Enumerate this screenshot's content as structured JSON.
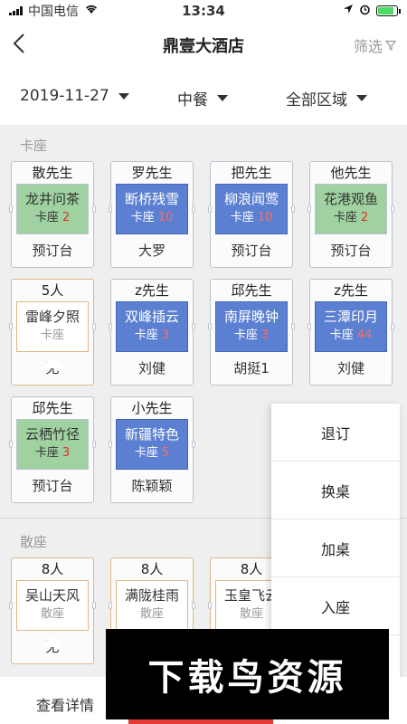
{
  "status": {
    "carrier": "中国电信",
    "time": "13:34"
  },
  "nav": {
    "title": "鼎壹大酒店",
    "filter_label": "筛选"
  },
  "filters": {
    "date": "2019-11-27",
    "meal": "中餐",
    "area": "全部区域"
  },
  "sections": {
    "booth": "卡座",
    "hall": "散座"
  },
  "booths": [
    {
      "top": "散先生",
      "name": "龙井问茶",
      "type": "卡座",
      "count": "2",
      "bottom": "预订台",
      "style": "green"
    },
    {
      "top": "罗先生",
      "name": "断桥残雪",
      "type": "卡座",
      "count": "10",
      "bottom": "大罗",
      "style": "blue"
    },
    {
      "top": "把先生",
      "name": "柳浪闻莺",
      "type": "卡座",
      "count": "10",
      "bottom": "预订台",
      "style": "blue"
    },
    {
      "top": "他先生",
      "name": "花港观鱼",
      "type": "卡座",
      "count": "2",
      "bottom": "预订台",
      "style": "green"
    },
    {
      "top": "5人",
      "name": "雷峰夕照",
      "type": "卡座",
      "count": "",
      "bottom": "无",
      "style": "orange"
    },
    {
      "top": "z先生",
      "name": "双峰插云",
      "type": "卡座",
      "count": "3",
      "bottom": "刘健",
      "style": "blue"
    },
    {
      "top": "邱先生",
      "name": "南屏晚钟",
      "type": "卡座",
      "count": "3",
      "bottom": "胡挺1",
      "style": "blue"
    },
    {
      "top": "z先生",
      "name": "三潭印月",
      "type": "卡座",
      "count": "44",
      "bottom": "刘健",
      "style": "blue"
    },
    {
      "top": "邱先生",
      "name": "云栖竹径",
      "type": "卡座",
      "count": "3",
      "bottom": "预订台",
      "style": "green"
    },
    {
      "top": "小先生",
      "name": "新疆特色",
      "type": "卡座",
      "count": "5",
      "bottom": "陈颖颖",
      "style": "blue"
    }
  ],
  "halls": [
    {
      "top": "8人",
      "name": "吴山天风",
      "type": "散座",
      "count": "",
      "bottom": "无",
      "style": "orange"
    },
    {
      "top": "8人",
      "name": "满陇桂雨",
      "type": "散座",
      "count": "",
      "bottom": "",
      "style": "orange"
    },
    {
      "top": "8人",
      "name": "玉皇飞云",
      "type": "散座",
      "count": "",
      "bottom": "",
      "style": "orange"
    }
  ],
  "menu": [
    "退订",
    "换桌",
    "加桌",
    "入座"
  ],
  "bottom": {
    "view_detail": "查看详情"
  },
  "watermark": "下载鸟资源",
  "colors": {
    "green": "#9fd2a0",
    "blue": "#5b7fd1",
    "orange": "#e0b686",
    "count_red": "#d9302a",
    "accent_red": "#e53935"
  }
}
